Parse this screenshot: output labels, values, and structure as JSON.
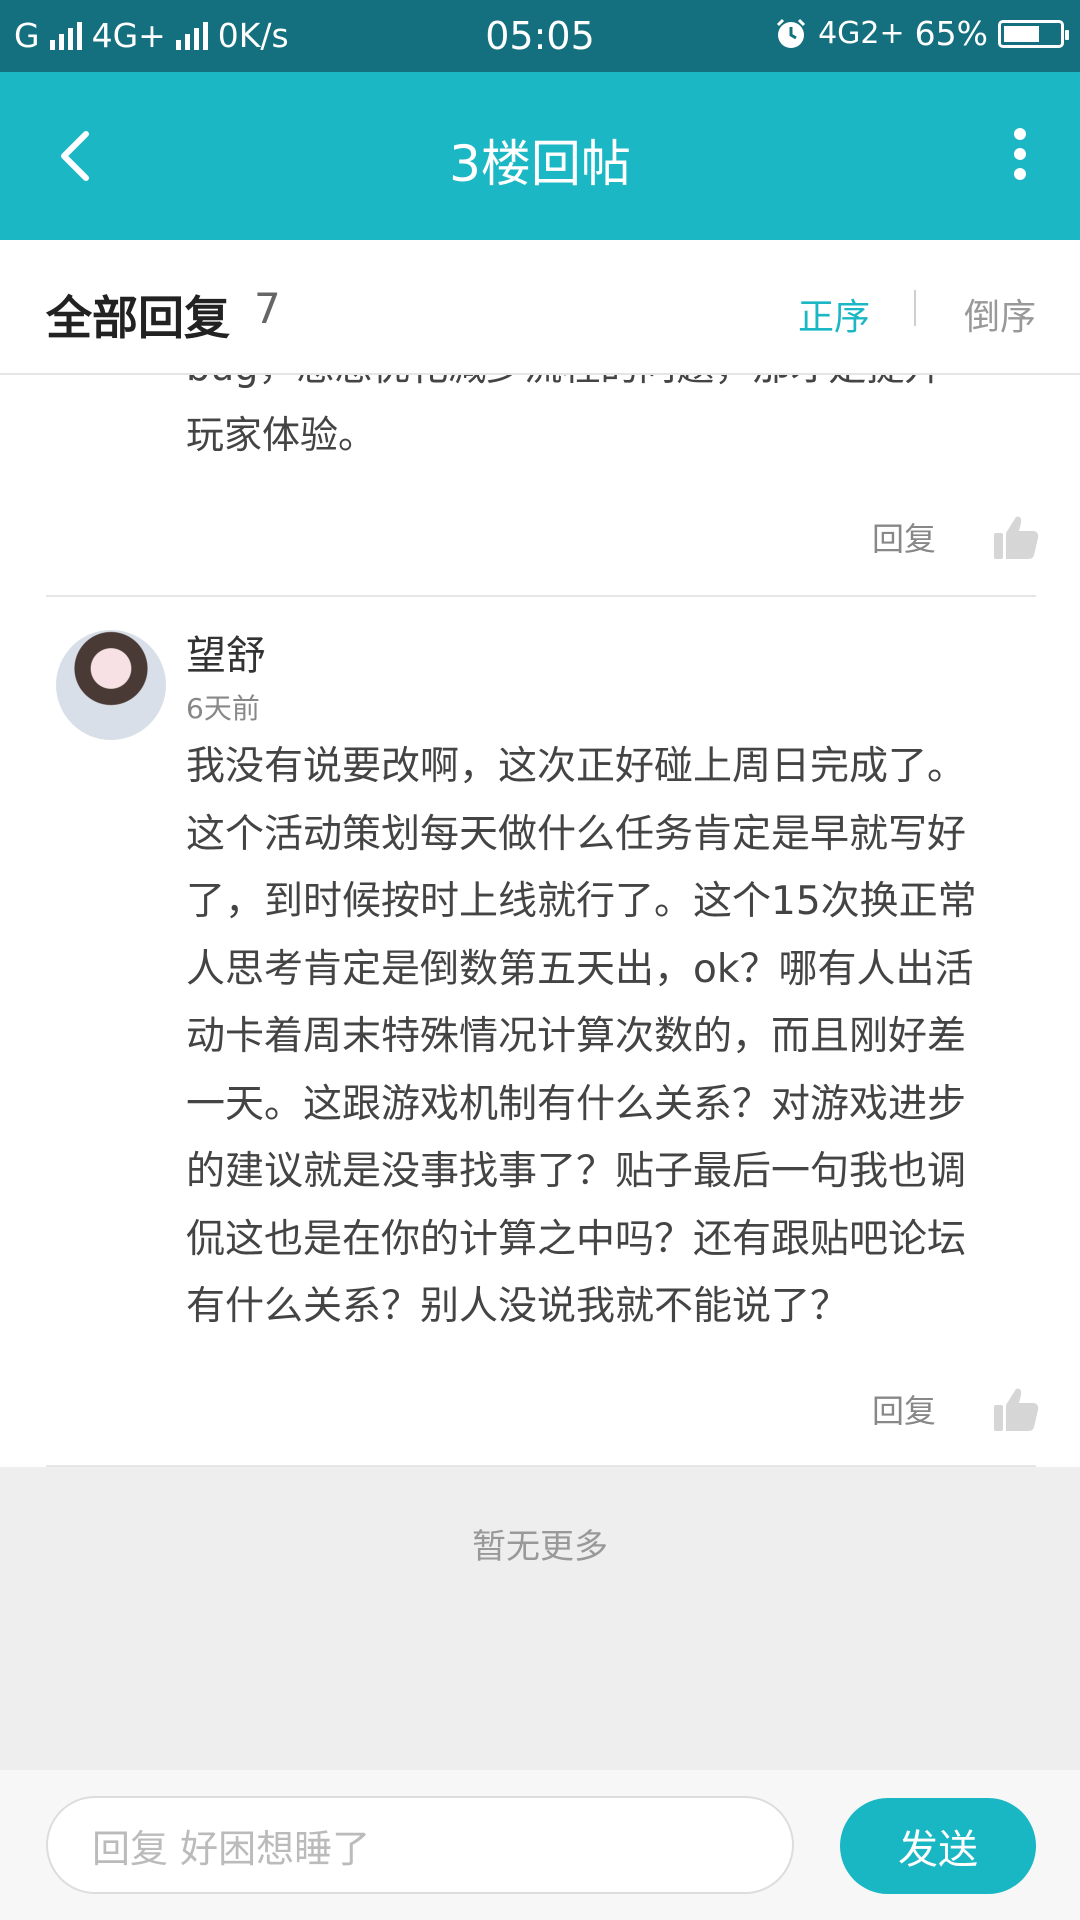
{
  "status_bar": {
    "carrier1": "G",
    "network": "4G+",
    "speed": "0K/s",
    "time": "05:05",
    "network2": "4G",
    "sim2": "2+",
    "battery_text": "65%",
    "battery_level": 0.65,
    "alarm_icon": "alarm-icon"
  },
  "titlebar": {
    "title": "3楼回帖",
    "back_icon": "back-chevron-icon",
    "more_icon": "more-vertical-icon"
  },
  "header": {
    "label": "全部回复",
    "count": "7",
    "sort_asc": "正序",
    "sort_desc": "倒序",
    "accent": "#1cb7c4"
  },
  "comments": [
    {
      "partial_lines": [
        "bug，想想优化减少流程的问题，那才是提升",
        "玩家体验。"
      ],
      "reply_label": "回复"
    },
    {
      "username": "望舒",
      "time": "6天前",
      "lines": [
        "我没有说要改啊，这次正好碰上周日完成了。",
        "这个活动策划每天做什么任务肯定是早就写好",
        "了，到时候按时上线就行了。这个15次换正常",
        "人思考肯定是倒数第五天出，ok？哪有人出活",
        "动卡着周末特殊情况计算次数的，而且刚好差",
        "一天。这跟游戏机制有什么关系？对游戏进步",
        "的建议就是没事找事了？贴子最后一句我也调",
        "侃这也是在你的计算之中吗？还有跟贴吧论坛",
        "有什么关系？别人没说我就不能说了？"
      ],
      "reply_label": "回复"
    }
  ],
  "footer": {
    "no_more": "暂无更多",
    "input_placeholder": "回复 好困想睡了",
    "send_label": "发送"
  }
}
